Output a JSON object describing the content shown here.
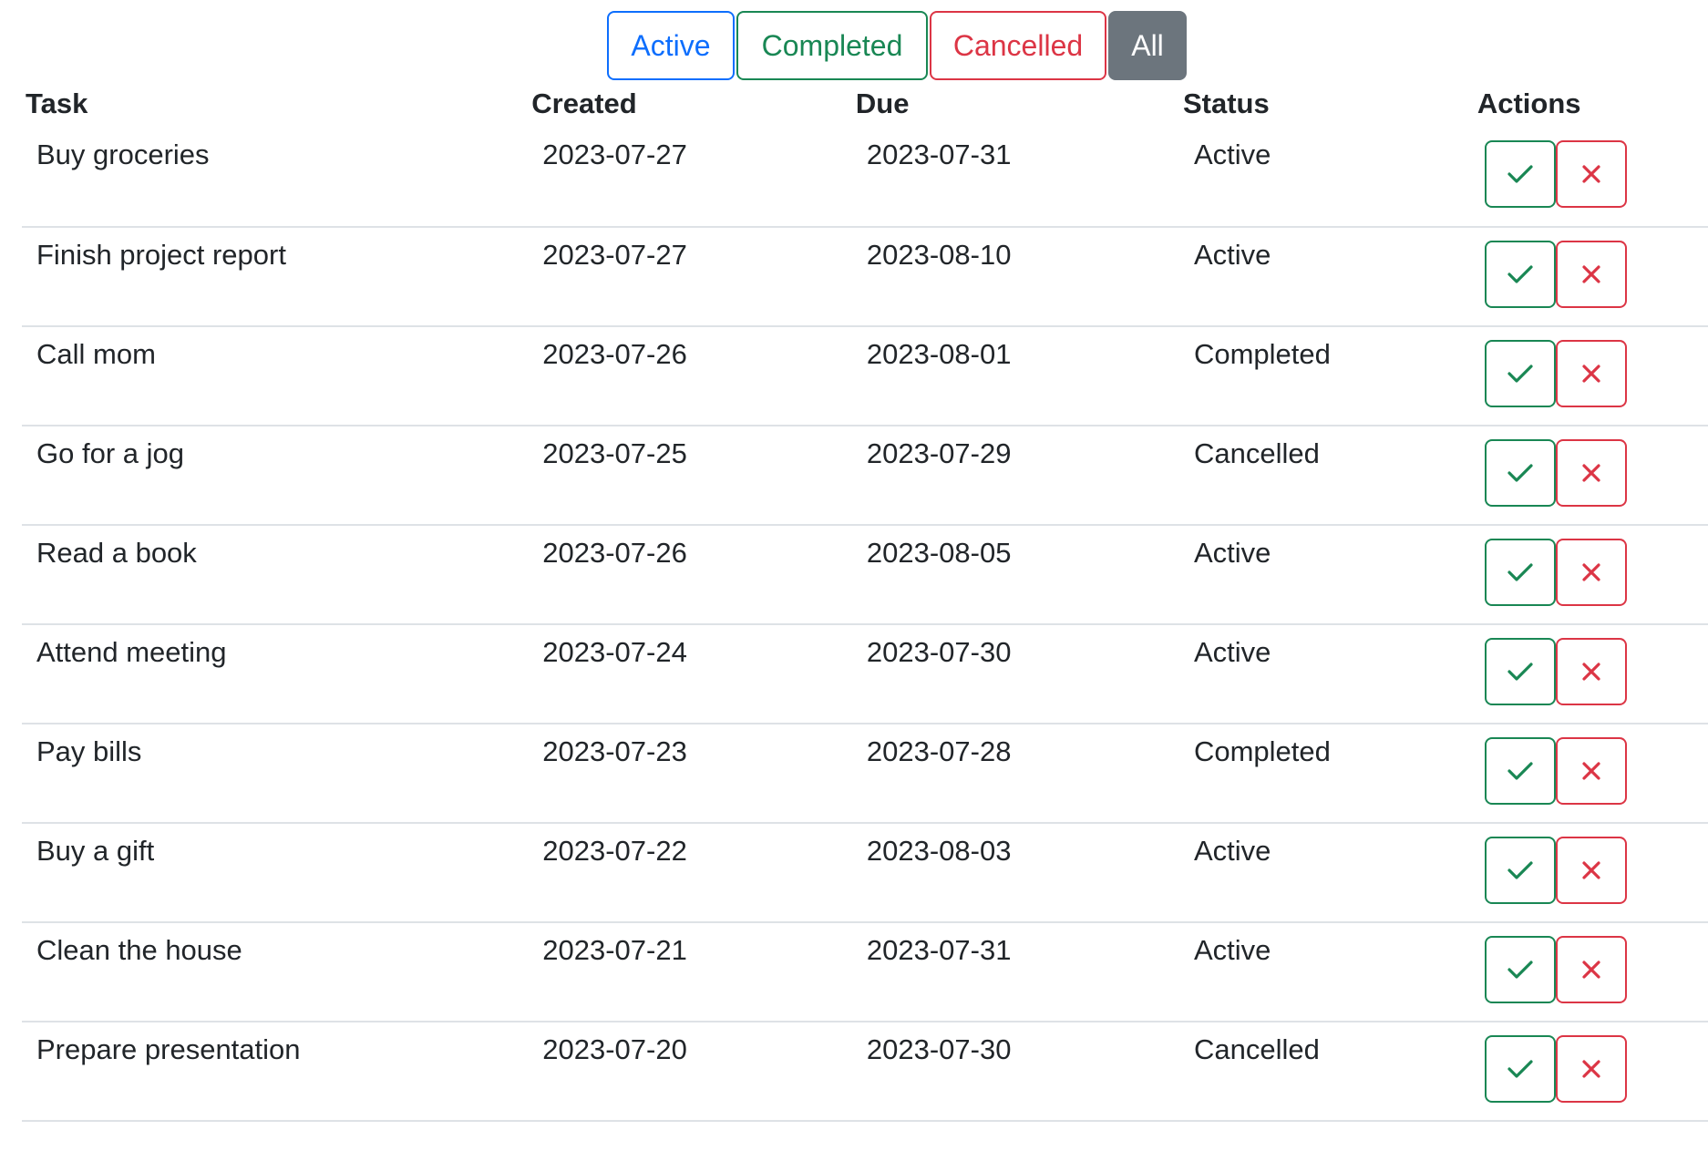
{
  "filters": [
    {
      "label": "Active",
      "key": "active"
    },
    {
      "label": "Completed",
      "key": "completed"
    },
    {
      "label": "Cancelled",
      "key": "cancelled"
    },
    {
      "label": "All",
      "key": "all",
      "selected": true
    }
  ],
  "table": {
    "headers": {
      "task": "Task",
      "created": "Created",
      "due": "Due",
      "status": "Status",
      "actions": "Actions"
    },
    "rows": [
      {
        "task": "Buy groceries",
        "created": "2023-07-27",
        "due": "2023-07-31",
        "status": "Active"
      },
      {
        "task": "Finish project report",
        "created": "2023-07-27",
        "due": "2023-08-10",
        "status": "Active"
      },
      {
        "task": "Call mom",
        "created": "2023-07-26",
        "due": "2023-08-01",
        "status": "Completed"
      },
      {
        "task": "Go for a jog",
        "created": "2023-07-25",
        "due": "2023-07-29",
        "status": "Cancelled"
      },
      {
        "task": "Read a book",
        "created": "2023-07-26",
        "due": "2023-08-05",
        "status": "Active"
      },
      {
        "task": "Attend meeting",
        "created": "2023-07-24",
        "due": "2023-07-30",
        "status": "Active"
      },
      {
        "task": "Pay bills",
        "created": "2023-07-23",
        "due": "2023-07-28",
        "status": "Completed"
      },
      {
        "task": "Buy a gift",
        "created": "2023-07-22",
        "due": "2023-08-03",
        "status": "Active"
      },
      {
        "task": "Clean the house",
        "created": "2023-07-21",
        "due": "2023-07-31",
        "status": "Active"
      },
      {
        "task": "Prepare presentation",
        "created": "2023-07-20",
        "due": "2023-07-30",
        "status": "Cancelled"
      }
    ]
  },
  "icons": {
    "complete": "check-icon",
    "cancel": "close-icon"
  },
  "colors": {
    "active": "#0d6efd",
    "completed": "#198754",
    "cancelled": "#dc3545",
    "all": "#6c757d"
  }
}
